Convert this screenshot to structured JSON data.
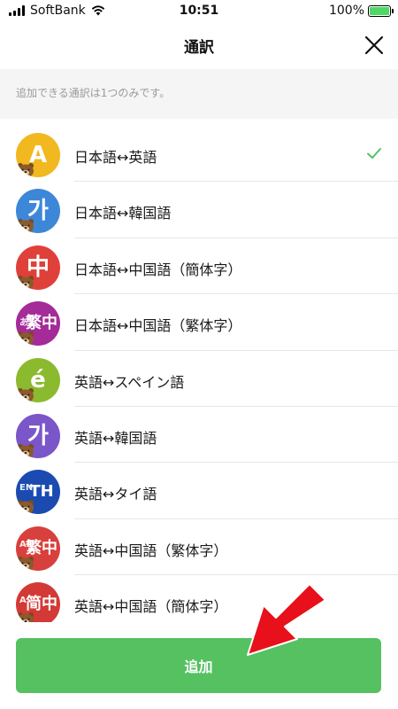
{
  "status": {
    "carrier": "SoftBank",
    "time": "10:51",
    "battery": "100%",
    "battery_level": 1.0
  },
  "header": {
    "title": "通訳",
    "close_icon": "close-icon"
  },
  "notice": {
    "text": "追加できる通訳は1つのみです。"
  },
  "languages": [
    {
      "label": "日本語↔英語",
      "glyph": "A",
      "prefix": "",
      "color": "#f1b81f",
      "selected": true
    },
    {
      "label": "日本語↔韓国語",
      "glyph": "가",
      "prefix": "",
      "color": "#3d87d8",
      "selected": false
    },
    {
      "label": "日本語↔中国語（簡体字）",
      "glyph": "中",
      "prefix": "",
      "color": "#e0403a",
      "selected": false
    },
    {
      "label": "日本語↔中国語（繁体字）",
      "glyph": "繁中",
      "prefix": "あ",
      "color": "#a42b98",
      "selected": false
    },
    {
      "label": "英語↔スペイン語",
      "glyph": "é",
      "prefix": "",
      "color": "#8cba2e",
      "selected": false
    },
    {
      "label": "英語↔韓国語",
      "glyph": "가",
      "prefix": "",
      "color": "#7b56c9",
      "selected": false
    },
    {
      "label": "英語↔タイ語",
      "glyph": "TH",
      "prefix": "EN",
      "color": "#1b4bb0",
      "selected": false
    },
    {
      "label": "英語↔中国語（繁体字）",
      "glyph": "繁中",
      "prefix": "A",
      "color": "#d8403d",
      "selected": false
    },
    {
      "label": "英語↔中国語（簡体字）",
      "glyph": "简中",
      "prefix": "A",
      "color": "#d33a36",
      "selected": false
    }
  ],
  "add_button": {
    "label": "追加"
  },
  "colors": {
    "accent": "#55c161",
    "check": "#55c161",
    "arrow": "#e8101a"
  }
}
